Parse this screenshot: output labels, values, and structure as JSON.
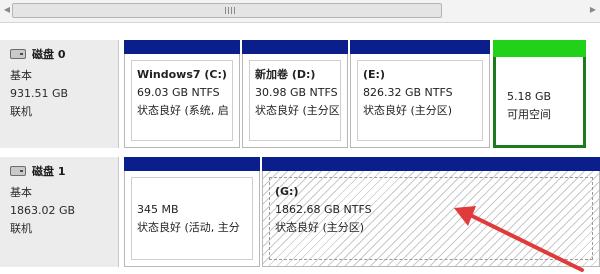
{
  "disks": [
    {
      "name": "磁盘 0",
      "type": "基本",
      "size": "931.51 GB",
      "status": "联机",
      "partitions": [
        {
          "title": "Windows7 (C:)",
          "size": "69.03 GB NTFS",
          "status": "状态良好 (系统, 启"
        },
        {
          "title": "新加卷 (D:)",
          "size": "30.98 GB NTFS",
          "status": "状态良好 (主分区)"
        },
        {
          "title": "(E:)",
          "size": "826.32 GB NTFS",
          "status": "状态良好 (主分区)"
        },
        {
          "title": "",
          "size": "5.18 GB",
          "status": "可用空间"
        }
      ]
    },
    {
      "name": "磁盘 1",
      "type": "基本",
      "size": "1863.02 GB",
      "status": "联机",
      "partitions": [
        {
          "title": "",
          "size": "345 MB",
          "status": "状态良好 (活动, 主分"
        },
        {
          "title": "(G:)",
          "size": "1862.68 GB NTFS",
          "status": "状态良好 (主分区)"
        }
      ]
    }
  ],
  "colors": {
    "primary_bar": "#0a1f8c",
    "free_space_bar": "#22d11a",
    "free_space_border": "#1e7a1e",
    "annotation_arrow": "#e03a3a"
  },
  "icons": [
    "disk-icon",
    "scrollbar-grip-icon",
    "red-annotation-arrow"
  ]
}
